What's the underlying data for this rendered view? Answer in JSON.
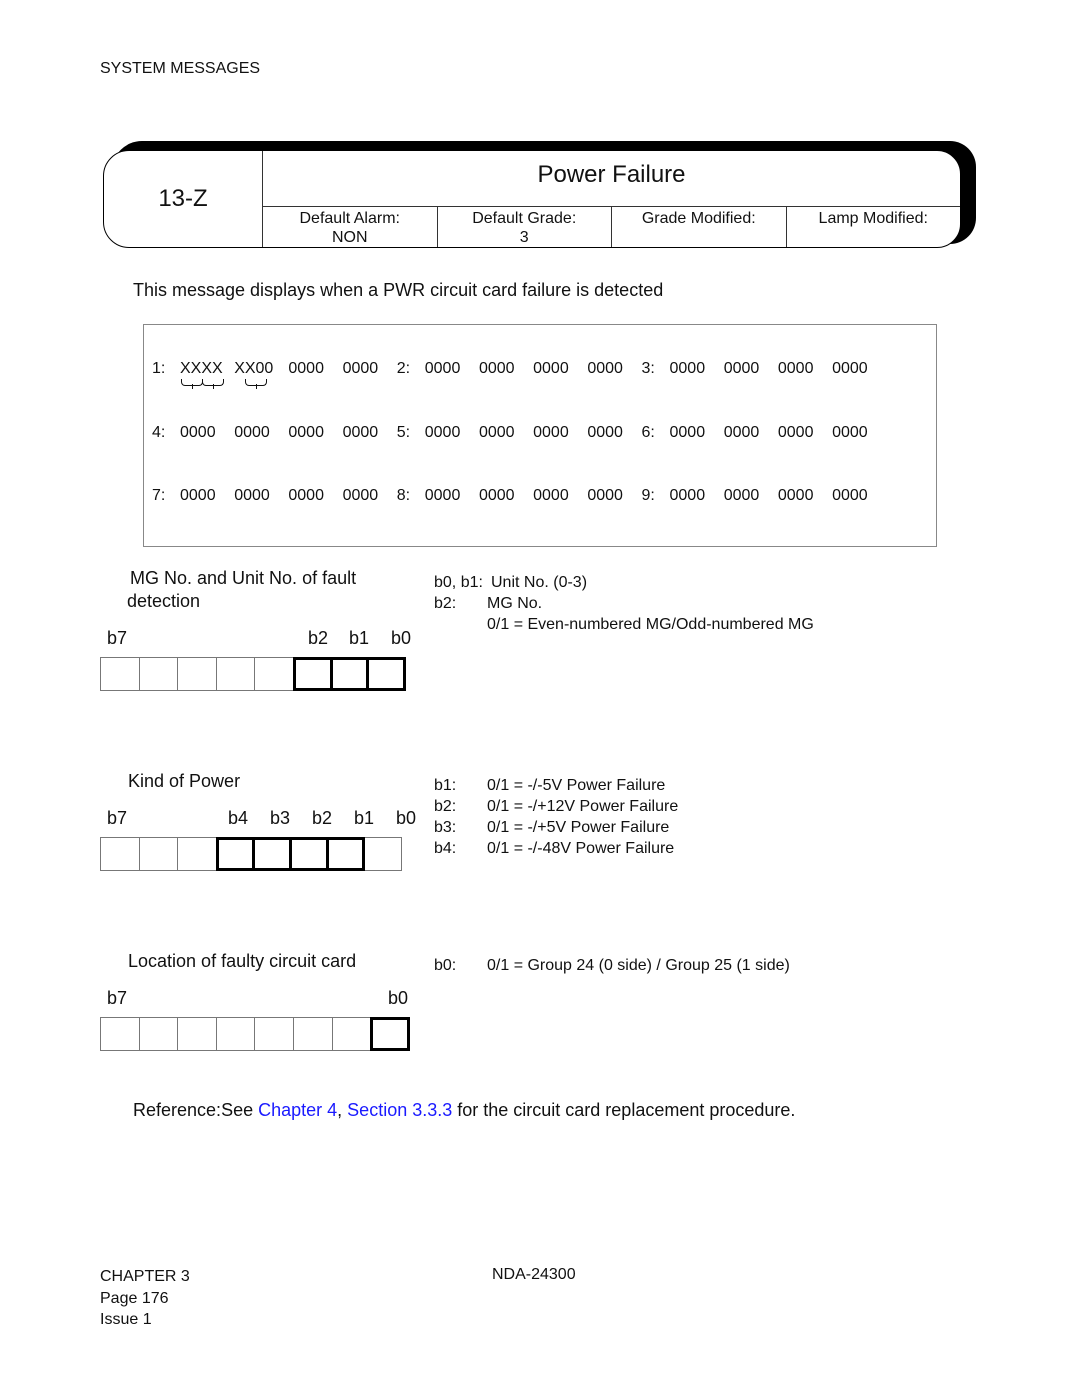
{
  "running_header": "SYSTEM MESSAGES",
  "title_block": {
    "code": "13-Z",
    "title": "Power Failure",
    "attributes": [
      {
        "label": "Default Alarm:",
        "value": "NON"
      },
      {
        "label": "Default Grade:",
        "value": "3"
      },
      {
        "label": "Grade Modified:",
        "value": ""
      },
      {
        "label": "Lamp Modified:",
        "value": ""
      }
    ]
  },
  "intro": "This message displays when a PWR circuit card failure is detected",
  "data_lines": [
    {
      "groups": [
        {
          "label": "1:",
          "words": [
            "XXXX",
            "XX00",
            "0000",
            "0000"
          ]
        },
        {
          "label": "2:",
          "words": [
            "0000",
            "0000",
            "0000",
            "0000"
          ]
        },
        {
          "label": "3:",
          "words": [
            "0000",
            "0000",
            "0000",
            "0000"
          ]
        }
      ]
    },
    {
      "groups": [
        {
          "label": "4:",
          "words": [
            "0000",
            "0000",
            "0000",
            "0000"
          ]
        },
        {
          "label": "5:",
          "words": [
            "0000",
            "0000",
            "0000",
            "0000"
          ]
        },
        {
          "label": "6:",
          "words": [
            "0000",
            "0000",
            "0000",
            "0000"
          ]
        }
      ]
    },
    {
      "groups": [
        {
          "label": "7:",
          "words": [
            "0000",
            "0000",
            "0000",
            "0000"
          ]
        },
        {
          "label": "8:",
          "words": [
            "0000",
            "0000",
            "0000",
            "0000"
          ]
        },
        {
          "label": "9:",
          "words": [
            "0000",
            "0000",
            "0000",
            "0000"
          ]
        }
      ]
    }
  ],
  "fields": [
    {
      "title_line1": "MG No. and Unit No. of fault",
      "title_line2": "detection",
      "bit_labels": {
        "b7": "b7",
        "b2": "b2",
        "b1": "b1",
        "b0": "b0"
      },
      "highlighted_bits": [
        "b2",
        "b1",
        "b0"
      ],
      "descriptions": [
        {
          "key": "b0, b1:",
          "text": "Unit No. (0-3)"
        },
        {
          "key": "b2:",
          "text": "MG No."
        },
        {
          "key": "",
          "text": "0/1 = Even-numbered MG/Odd-numbered MG"
        }
      ]
    },
    {
      "title_line1": "Kind of Power",
      "bit_labels": {
        "b7": "b7",
        "b4": "b4",
        "b3": "b3",
        "b2": "b2",
        "b1": "b1",
        "b0": "b0"
      },
      "highlighted_bits": [
        "b4",
        "b3",
        "b2",
        "b1"
      ],
      "descriptions": [
        {
          "key": "b1:",
          "text": "0/1 = -/-5V Power Failure"
        },
        {
          "key": "b2:",
          "text": "0/1 = -/+12V Power Failure"
        },
        {
          "key": "b3:",
          "text": "0/1 = -/+5V Power Failure"
        },
        {
          "key": "b4:",
          "text": "0/1 = -/-48V Power Failure"
        }
      ]
    },
    {
      "title_line1": "Location of faulty circuit card",
      "bit_labels": {
        "b7": "b7",
        "b0": "b0"
      },
      "highlighted_bits": [
        "b0"
      ],
      "descriptions": [
        {
          "key": "b0:",
          "text": "0/1 = Group 24 (0 side) / Group 25 (1 side)"
        }
      ]
    }
  ],
  "reference": {
    "prefix": "Reference:",
    "see": "See ",
    "link_chapter": "Chapter 4",
    "separator": ", ",
    "link_section": "Section 3.3.3",
    "suffix": " for the circuit card replacement procedure."
  },
  "footer": {
    "chapter": "CHAPTER 3",
    "page": "Page 176",
    "issue": "Issue 1",
    "doc_number": "NDA-24300"
  }
}
